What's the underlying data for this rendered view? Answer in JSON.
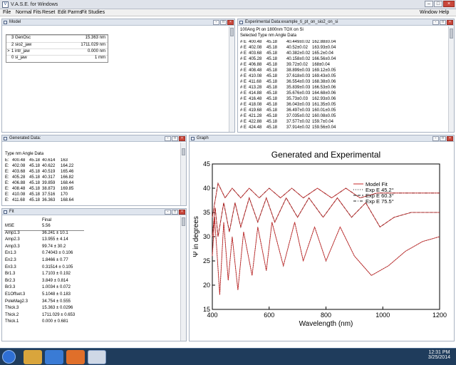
{
  "window": {
    "title": "V.A.S.E. for Windows",
    "app_icon": "V"
  },
  "menu": [
    "File",
    "Normal Fits",
    "Reset",
    "Edit Parms",
    "Fit Studies",
    "Window",
    "Help"
  ],
  "model": {
    "title": "Model",
    "layers": [
      {
        "mark": "",
        "name": "3 GenOsc",
        "thickness": "15.363 nm"
      },
      {
        "mark": "",
        "name": "2 sio2_jaw",
        "thickness": "1711.029 nm"
      },
      {
        "mark": ">",
        "name": "1 intr_jaw",
        "thickness": "0.000 nm"
      },
      {
        "mark": "",
        "name": "0 si_jaw",
        "thickness": "1 mm"
      }
    ]
  },
  "experimental": {
    "title": "Experimental Data:example_ti_pt_on_sio2_on_si",
    "description": "100Ang Pt on 1800nm TOX on Si",
    "header": "Selected Type  nm  Angle  Data",
    "rows": [
      [
        "#",
        "E",
        "400.48",
        "45.18",
        "40.449±0.02",
        "162.88±0.04"
      ],
      [
        "#",
        "E",
        "402.08",
        "45.18",
        "40.52±0.02",
        "163.93±0.04"
      ],
      [
        "#",
        "E",
        "403.68",
        "45.18",
        "40.382±0.02",
        "165.2±0.04"
      ],
      [
        "#",
        "E",
        "405.28",
        "45.18",
        "40.158±0.02",
        "166.56±0.04"
      ],
      [
        "#",
        "E",
        "406.88",
        "45.18",
        "39.72±0.02",
        "168±0.04"
      ],
      [
        "#",
        "E",
        "408.48",
        "45.18",
        "38.899±0.03",
        "169.12±0.05"
      ],
      [
        "#",
        "E",
        "410.08",
        "45.18",
        "37.618±0.03",
        "169.43±0.05"
      ],
      [
        "#",
        "E",
        "411.68",
        "45.18",
        "36.554±0.03",
        "168.38±0.06"
      ],
      [
        "#",
        "E",
        "413.28",
        "45.18",
        "35.839±0.03",
        "166.53±0.06"
      ],
      [
        "#",
        "E",
        "414.88",
        "45.18",
        "35.676±0.03",
        "164.68±0.06"
      ],
      [
        "#",
        "E",
        "416.48",
        "45.18",
        "35.73±0.03",
        "162.93±0.06"
      ],
      [
        "#",
        "E",
        "418.08",
        "45.18",
        "36.043±0.03",
        "161.35±0.05"
      ],
      [
        "#",
        "E",
        "419.68",
        "45.18",
        "36.497±0.03",
        "160.01±0.05"
      ],
      [
        "#",
        "E",
        "421.28",
        "45.18",
        "37.035±0.02",
        "160.08±0.05"
      ],
      [
        "#",
        "E",
        "422.88",
        "45.18",
        "37.577±0.02",
        "159.7±0.04"
      ],
      [
        "#",
        "E",
        "424.48",
        "45.18",
        "37.914±0.02",
        "159.56±0.04"
      ]
    ]
  },
  "generated": {
    "title": "Generated Data:",
    "header": "Type  nm  Angle  Data",
    "rows": [
      [
        "E:",
        "400.48",
        "45.18",
        "40.614",
        "163"
      ],
      [
        "E:",
        "402.08",
        "45.18",
        "40.622",
        "164.22"
      ],
      [
        "E:",
        "403.68",
        "45.18",
        "40.519",
        "165.46"
      ],
      [
        "E:",
        "405.28",
        "45.18",
        "40.317",
        "166.82"
      ],
      [
        "E:",
        "406.88",
        "45.18",
        "39.859",
        "168.44"
      ],
      [
        "E:",
        "408.48",
        "45.18",
        "38.873",
        "169.85"
      ],
      [
        "E:",
        "410.08",
        "45.18",
        "37.516",
        "170"
      ],
      [
        "E:",
        "411.68",
        "45.18",
        "36.363",
        "168.64"
      ]
    ]
  },
  "fit": {
    "title": "Fit",
    "col_header": "Final",
    "rows": [
      [
        "MSE",
        "5.56"
      ],
      [
        "Amp1.3",
        "36.241 ± 10.1"
      ],
      [
        "Amp2.3",
        "13.955 ± 4.14"
      ],
      [
        "Amp3.3",
        "99.74 ± 30.2"
      ],
      [
        "En1.3",
        "0.74043 ± 0.106"
      ],
      [
        "En2.3",
        "1.8466 ± 0.77"
      ],
      [
        "En3.3",
        "0.31514 ± 0.105"
      ],
      [
        "Br1.3",
        "1.7103 ± 0.192"
      ],
      [
        "Br2.3",
        "3.849 ± 0.814"
      ],
      [
        "Br3.3",
        "1.0034 ± 0.072"
      ],
      [
        "E1Offset.3",
        "5.1048 ± 0.183"
      ],
      [
        "PoleMag2.3",
        "34.754 ± 0.555"
      ],
      [
        "Thick.3",
        "15.363 ± 0.0296"
      ],
      [
        "Thick.2",
        "1711.029 ± 0.653"
      ],
      [
        "Thick.1",
        "0.000 ± 0.681"
      ]
    ]
  },
  "graph": {
    "panel_title": "Graph",
    "legend": [
      "Model Fit",
      "Exp E 45.2°",
      "Exp E 60.3°",
      "Exp E 75.5°"
    ],
    "legend_styles": [
      "solid",
      "dot",
      "dash",
      "dashdot"
    ],
    "colors": {
      "model": "#c62828",
      "exp": "#222222"
    }
  },
  "chart_data": {
    "type": "line",
    "title": "Generated and Experimental",
    "xlabel": "Wavelength (nm)",
    "ylabel": "Ψ in degrees",
    "xlim": [
      400,
      1200
    ],
    "ylim": [
      15,
      45
    ],
    "xticks": [
      400,
      600,
      800,
      1000,
      1200
    ],
    "yticks": [
      15,
      20,
      25,
      30,
      35,
      40,
      45
    ],
    "series": [
      {
        "name": "Exp E 45.2°",
        "x": [
          400,
          408,
          416,
          426,
          440,
          456,
          470,
          490,
          510,
          540,
          560,
          590,
          610,
          650,
          690,
          720,
          760,
          800,
          850,
          900,
          960,
          1020,
          1080,
          1140,
          1200
        ],
        "values": [
          26,
          34,
          27,
          18,
          33,
          21,
          30,
          19,
          31,
          22,
          32,
          23,
          33,
          24,
          33,
          25,
          32,
          25,
          32,
          26,
          22,
          24,
          27,
          29,
          30
        ]
      },
      {
        "name": "Exp E 60.3°",
        "x": [
          400,
          410,
          420,
          440,
          460,
          480,
          500,
          530,
          560,
          590,
          620,
          660,
          700,
          740,
          790,
          840,
          890,
          940,
          990,
          1040,
          1100,
          1160,
          1200
        ],
        "values": [
          30,
          36,
          30,
          37,
          31,
          37,
          32,
          38,
          33,
          38,
          33,
          38,
          34,
          38,
          34,
          38,
          34,
          37,
          32,
          34,
          35,
          35,
          35
        ]
      },
      {
        "name": "Exp E 75.5°",
        "x": [
          400,
          420,
          445,
          470,
          500,
          530,
          565,
          600,
          640,
          680,
          720,
          770,
          820,
          870,
          920,
          980,
          1040,
          1100,
          1160,
          1200
        ],
        "values": [
          34,
          41,
          38,
          40,
          38,
          40,
          38,
          40,
          38,
          40,
          38,
          40,
          38,
          40,
          38,
          39,
          39,
          39,
          39,
          39
        ]
      }
    ]
  },
  "taskbar": {
    "time": "12:31 PM",
    "date": "3/25/2014"
  }
}
